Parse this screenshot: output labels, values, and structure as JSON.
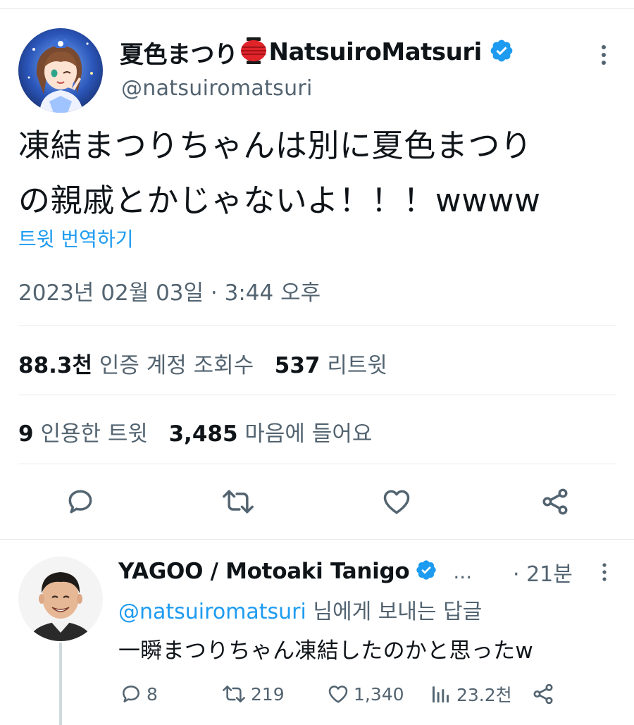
{
  "tweet": {
    "display_name": "夏色まつり",
    "display_name_suffix": "NatsuiroMatsuri",
    "handle": "@natsuiromatsuri",
    "text_line1": "凍結まつりちゃんは別に夏色まつり",
    "text_line2": "の親戚とかじゃないよ！！！wwww",
    "translate_link": "트윗 번역하기",
    "timestamp": "2023년 02월 03일 · 3:44 오후",
    "views_count": "88.3천",
    "views_label": "인증 계정 조회수",
    "retweets_count": "537",
    "retweets_label": "리트윗",
    "quotes_count": "9",
    "quotes_label": "인용한 트윗",
    "likes_count": "3,485",
    "likes_label": "마음에 들어요"
  },
  "reply": {
    "display_name": "YAGOO / Motoaki Tanigo",
    "ellipsis": "...",
    "time": "· 21분",
    "reply_to_handle": "@natsuiromatsuri",
    "reply_to_suffix": " 님에게 보내는 답글",
    "text": "一瞬まつりちゃん凍結したのかと思ったw",
    "reply_count": "8",
    "retweet_count": "219",
    "like_count": "1,340",
    "view_count": "23.2천"
  },
  "colors": {
    "accent": "#1d9bf0",
    "text_primary": "#0f1419",
    "text_secondary": "#536471",
    "divider": "#e6e9ea",
    "lantern_red": "#e0242a"
  },
  "icons": {
    "main_actions": [
      "reply-icon",
      "retweet-icon",
      "like-icon",
      "share-icon"
    ],
    "reply_actions": [
      "reply-icon",
      "retweet-icon",
      "like-icon",
      "analytics-icon",
      "share-icon"
    ],
    "header": [
      "lantern-icon",
      "verified-badge-icon",
      "more-icon"
    ]
  }
}
